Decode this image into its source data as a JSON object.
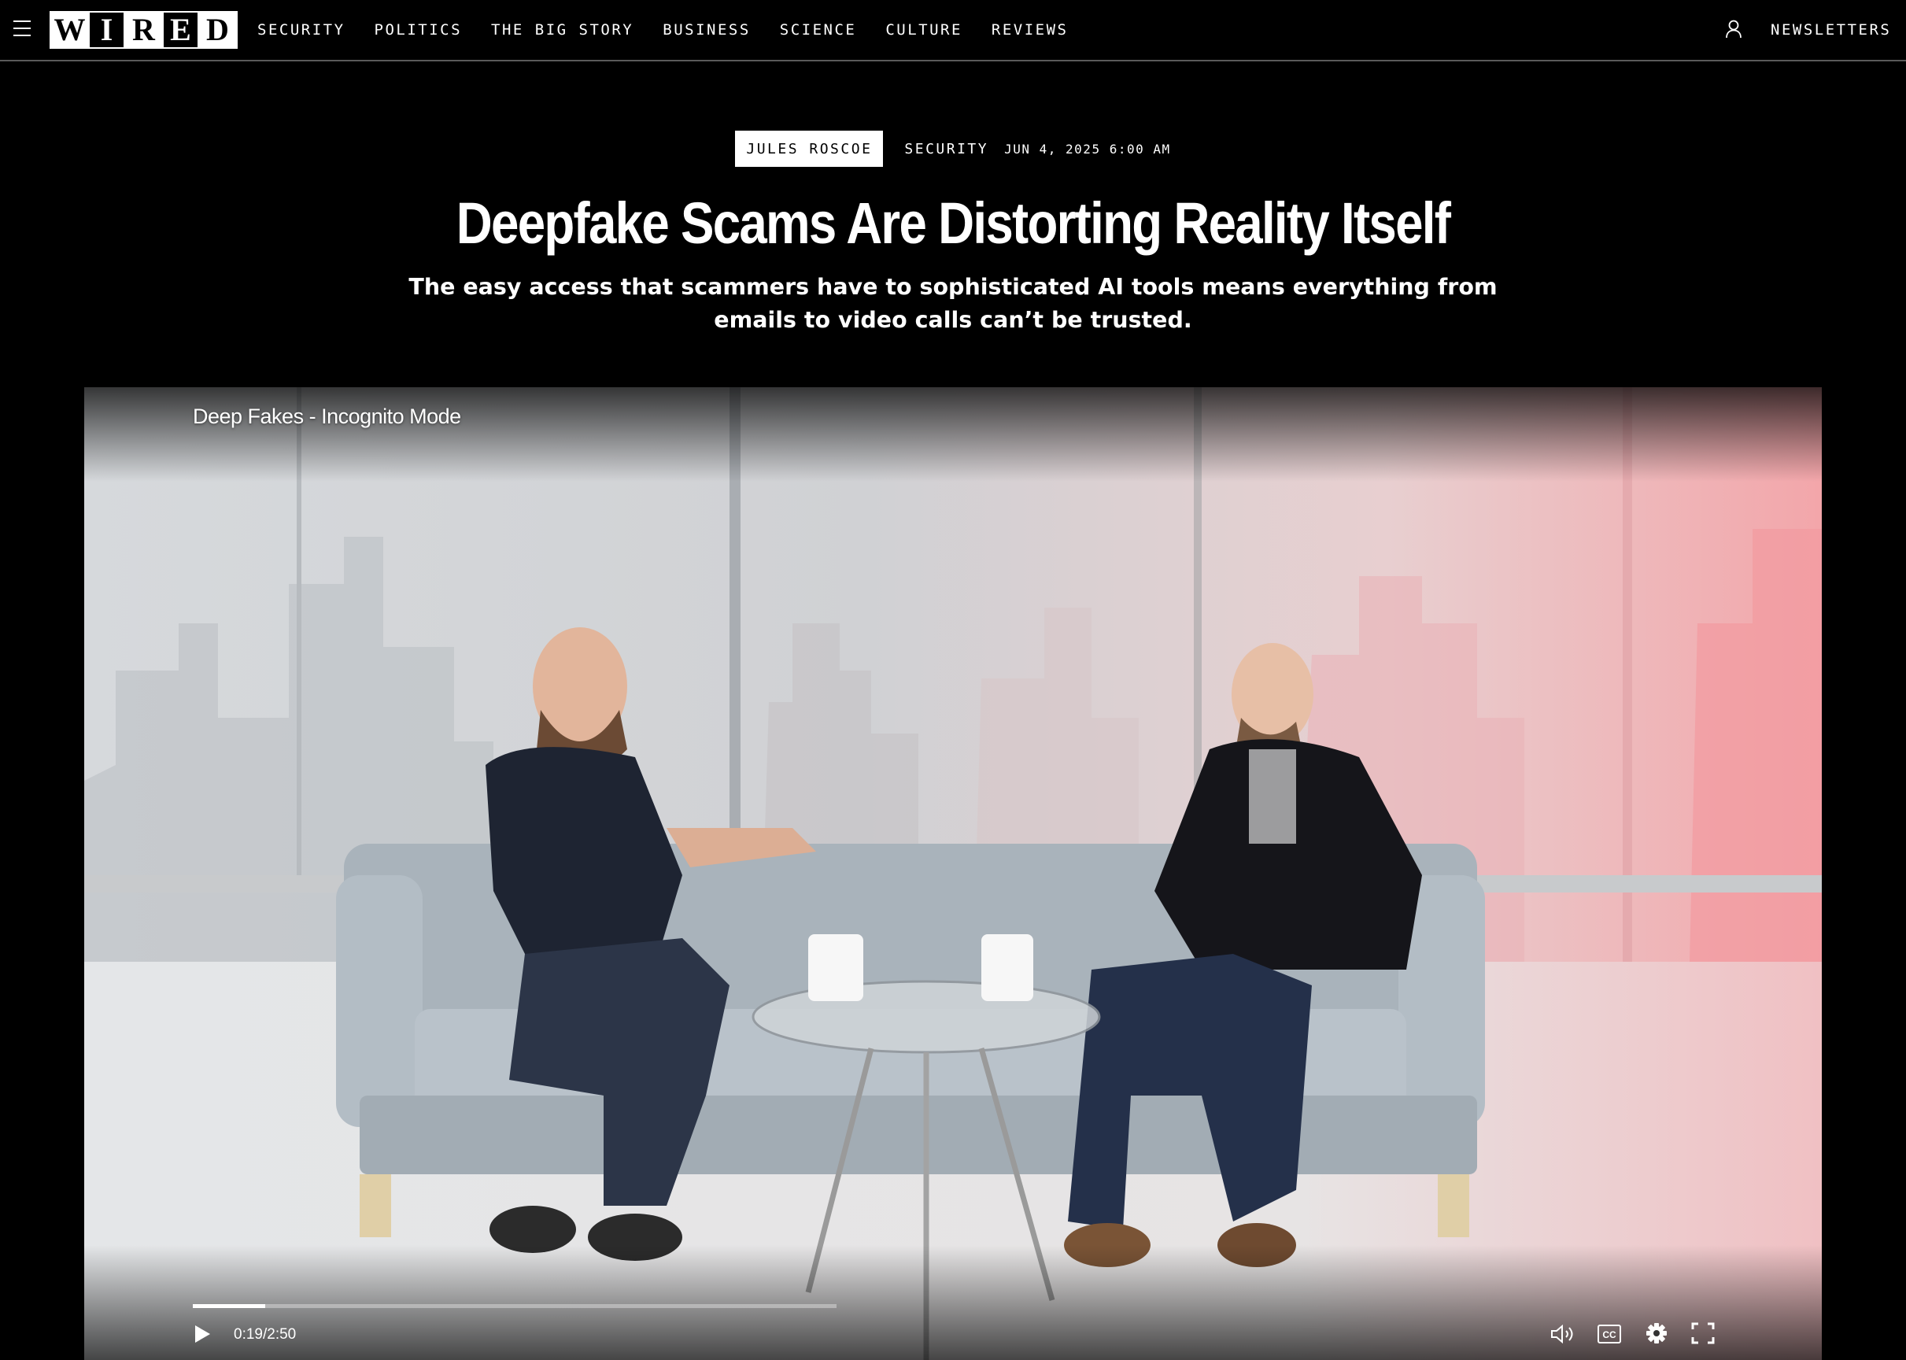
{
  "nav": {
    "logo_letters": [
      "W",
      "I",
      "R",
      "E",
      "D"
    ],
    "links": [
      "SECURITY",
      "POLITICS",
      "THE BIG STORY",
      "BUSINESS",
      "SCIENCE",
      "CULTURE",
      "REVIEWS"
    ],
    "newsletters": "NEWSLETTERS",
    "menu_icon": "hamburger-menu-icon",
    "user_icon": "user-icon"
  },
  "article": {
    "author": "JULES ROSCOE",
    "rubric": "SECURITY",
    "date": "JUN 4, 2025 6:00 AM",
    "headline": "Deepfake Scams Are Distorting Reality Itself",
    "dek": "The easy access that scammers have to sophisticated AI tools means everything from emails to video calls can’t be trusted."
  },
  "video": {
    "title": "Deep Fakes - Incognito Mode",
    "time": "0:19/2:50",
    "progress": 0.112,
    "controls": [
      "play-icon",
      "volume-icon",
      "closed-captions-icon",
      "settings-gear-icon",
      "fullscreen-icon"
    ]
  }
}
